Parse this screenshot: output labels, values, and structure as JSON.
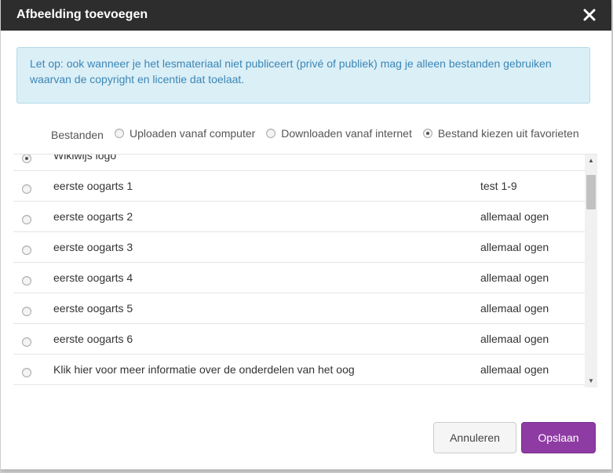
{
  "dialog": {
    "title": "Afbeelding toevoegen",
    "close_icon": "close-icon",
    "notice": "Let op: ook wanneer je het lesmateriaal niet publiceert (privé of publiek) mag je alleen bestanden gebruiken waarvan de copyright en licentie dat toelaat."
  },
  "source": {
    "label": "Bestanden",
    "options": [
      {
        "label": "Uploaden vanaf computer",
        "selected": false
      },
      {
        "label": "Downloaden vanaf internet",
        "selected": false
      },
      {
        "label": "Bestand kiezen uit favorieten",
        "selected": true
      }
    ]
  },
  "files": [
    {
      "name": "Wikiwijs logo",
      "tag": "",
      "selected": true
    },
    {
      "name": "eerste oogarts 1",
      "tag": "test 1-9",
      "selected": false
    },
    {
      "name": "eerste oogarts 2",
      "tag": "allemaal ogen",
      "selected": false
    },
    {
      "name": "eerste oogarts 3",
      "tag": "allemaal ogen",
      "selected": false
    },
    {
      "name": "eerste oogarts 4",
      "tag": "allemaal ogen",
      "selected": false
    },
    {
      "name": "eerste oogarts 5",
      "tag": "allemaal ogen",
      "selected": false
    },
    {
      "name": "eerste oogarts 6",
      "tag": "allemaal ogen",
      "selected": false
    },
    {
      "name": "Klik hier voor meer informatie over de onderdelen van het oog",
      "tag": "allemaal ogen",
      "selected": false
    }
  ],
  "buttons": {
    "cancel": "Annuleren",
    "save": "Opslaan"
  },
  "colors": {
    "titlebar": "#2d2d2d",
    "notice_bg": "#dbeff7",
    "notice_text": "#3b86b5",
    "save_button": "#8e3ca3"
  }
}
